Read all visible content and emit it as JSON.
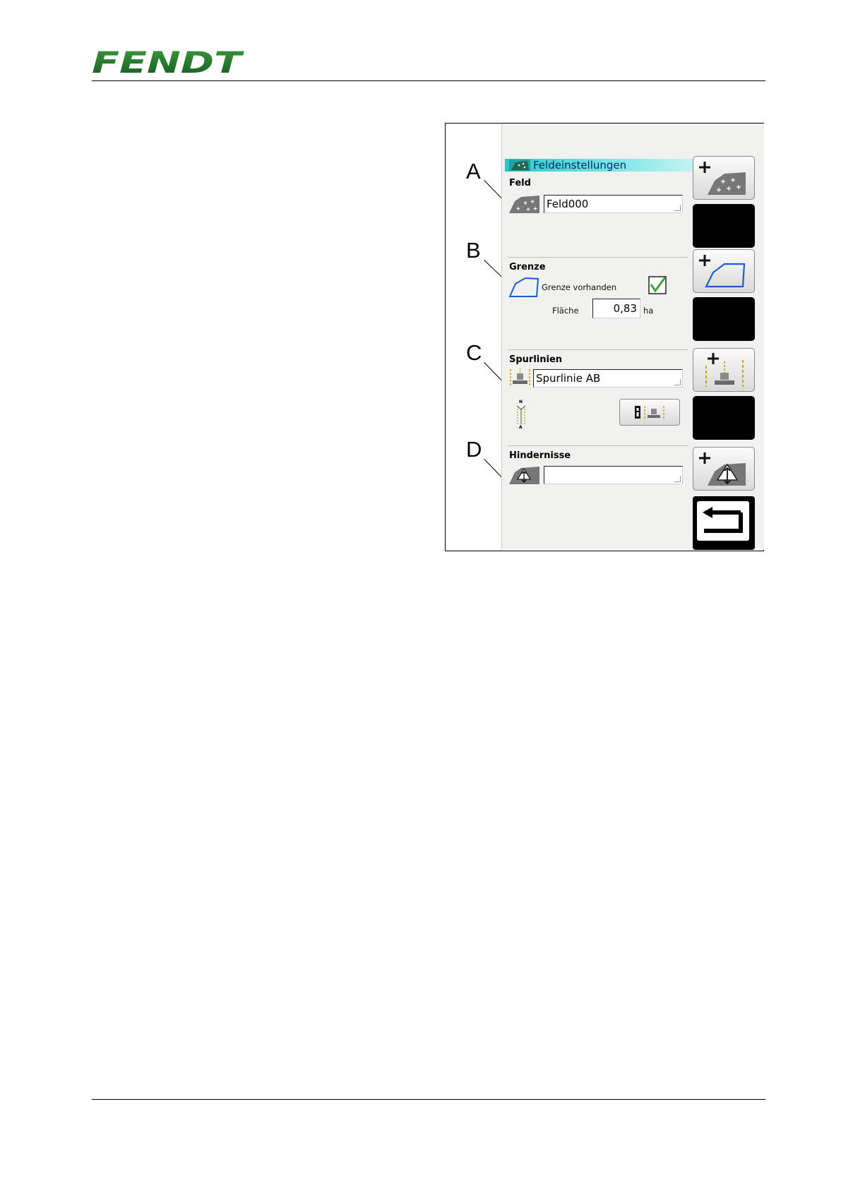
{
  "header": {
    "brand": "FENDT",
    "brand_color": "#1f6e2b"
  },
  "figure": {
    "callouts": [
      "A",
      "B",
      "C",
      "D"
    ],
    "screen": {
      "title": "Feldeinstellungen",
      "title_icon": "field-settings-icon",
      "sections": {
        "feld": {
          "label": "Feld",
          "value": "Feld000",
          "icon": "field-icon"
        },
        "grenze": {
          "label": "Grenze",
          "icon": "boundary-icon",
          "checkbox_label": "Grenze vorhanden",
          "checked": true,
          "area_label": "Fläche",
          "area_value": "0,83",
          "area_unit": "ha"
        },
        "spurlinien": {
          "label": "Spurlinien",
          "value": "Spurlinie AB",
          "icon": "guidance-line-icon",
          "compass_icon": "north-compass-icon",
          "button_icon": "guidance-info-icon"
        },
        "hindernisse": {
          "label": "Hindernisse",
          "value": "",
          "icon": "obstacle-icon"
        }
      },
      "softkeys": [
        {
          "name": "add-field-softkey",
          "icon": "add-field-icon"
        },
        {
          "name": "softkey-blank-1",
          "icon": ""
        },
        {
          "name": "add-boundary-softkey",
          "icon": "add-boundary-icon"
        },
        {
          "name": "softkey-blank-2",
          "icon": ""
        },
        {
          "name": "add-guidance-line-softkey",
          "icon": "add-guidance-line-icon"
        },
        {
          "name": "softkey-blank-3",
          "icon": ""
        },
        {
          "name": "add-obstacle-softkey",
          "icon": "add-obstacle-icon"
        },
        {
          "name": "back-softkey",
          "icon": "back-arrow-icon"
        }
      ]
    }
  }
}
